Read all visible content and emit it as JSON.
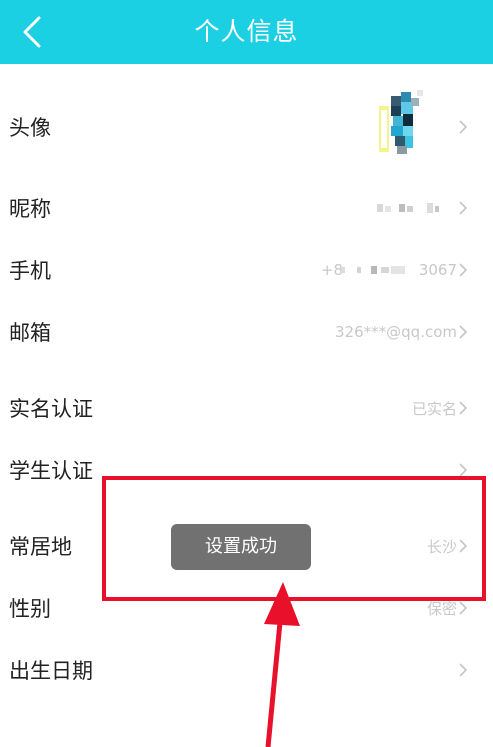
{
  "header": {
    "title": "个人信息",
    "background": "#1cd0e4"
  },
  "rows": [
    {
      "label": "头像",
      "value": ""
    },
    {
      "label": "昵称",
      "value": ""
    },
    {
      "label": "手机",
      "value": "3067"
    },
    {
      "label": "邮箱",
      "value": "326***@qq.com"
    },
    {
      "label": "实名认证",
      "value": "已实名"
    },
    {
      "label": "学生认证",
      "value": ""
    },
    {
      "label": "常居地",
      "value": "长沙"
    },
    {
      "label": "性别",
      "value": "保密"
    },
    {
      "label": "出生日期",
      "value": ""
    }
  ],
  "phone_prefix": "+8",
  "toast": {
    "text": "设置成功"
  },
  "icons": {
    "back": "chevron-left-icon",
    "row": "chevron-right-icon"
  },
  "annotation_color": "#e8102a"
}
